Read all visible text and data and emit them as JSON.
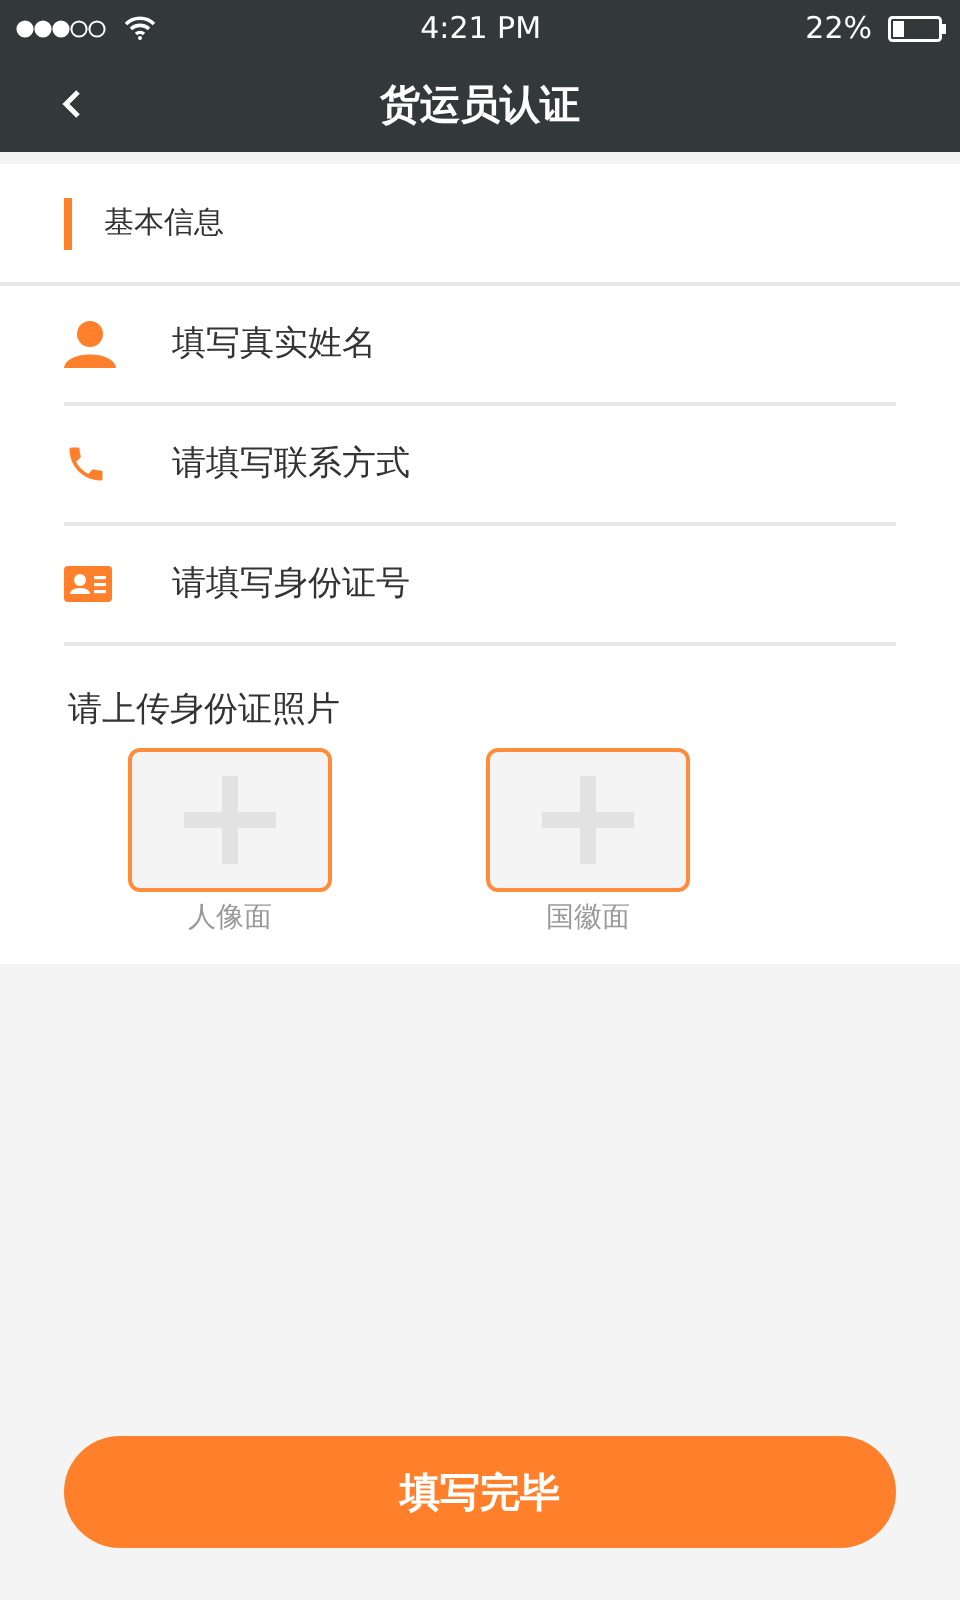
{
  "status_bar": {
    "time": "4:21 PM",
    "battery": "22%"
  },
  "nav": {
    "title": "货运员认证"
  },
  "section": {
    "title": "基本信息"
  },
  "fields": [
    {
      "kind": "person",
      "placeholder": "填写真实姓名"
    },
    {
      "kind": "phone",
      "placeholder": "请填写联系方式"
    },
    {
      "kind": "id-card",
      "placeholder": "请填写身份证号"
    }
  ],
  "upload": {
    "label": "请上传身份证照片",
    "slots": [
      {
        "caption": "人像面"
      },
      {
        "caption": "国徽面"
      }
    ]
  },
  "submit": {
    "label": "填写完毕"
  }
}
